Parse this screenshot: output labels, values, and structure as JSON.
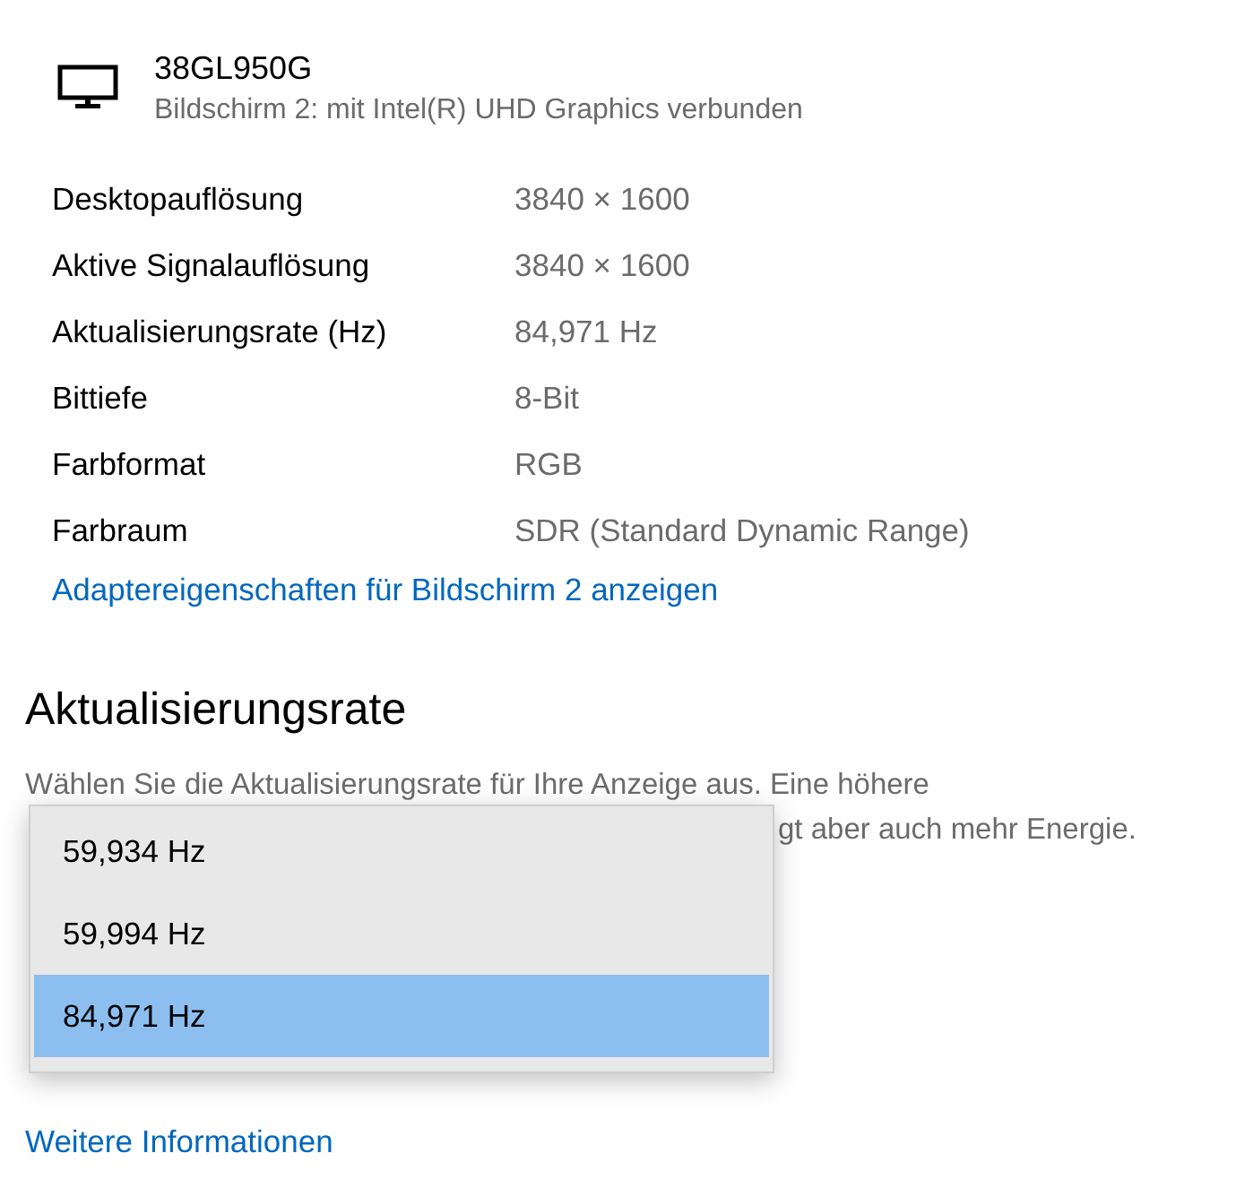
{
  "display": {
    "name": "38GL950G",
    "subtitle": "Bildschirm 2: mit Intel(R) UHD Graphics verbunden"
  },
  "properties": [
    {
      "label": "Desktopauflösung",
      "value": "3840 × 1600"
    },
    {
      "label": "Aktive Signalauflösung",
      "value": "3840 × 1600"
    },
    {
      "label": "Aktualisierungsrate (Hz)",
      "value": "84,971 Hz"
    },
    {
      "label": "Bittiefe",
      "value": "8-Bit"
    },
    {
      "label": "Farbformat",
      "value": "RGB"
    },
    {
      "label": "Farbraum",
      "value": "SDR (Standard Dynamic Range)"
    }
  ],
  "adapter_link": "Adaptereigenschaften für Bildschirm 2 anzeigen",
  "refresh_section": {
    "heading": "Aktualisierungsrate",
    "description_lines": [
      "Wählen Sie die Aktualisierungsrate für Ihre Anzeige aus. Eine höhere",
      "gt aber auch mehr Energie."
    ]
  },
  "dropdown": [
    {
      "label": "59,934 Hz",
      "selected": false
    },
    {
      "label": "59,994 Hz",
      "selected": false
    },
    {
      "label": "84,971 Hz",
      "selected": true
    }
  ],
  "more_info_link": "Weitere Informationen"
}
